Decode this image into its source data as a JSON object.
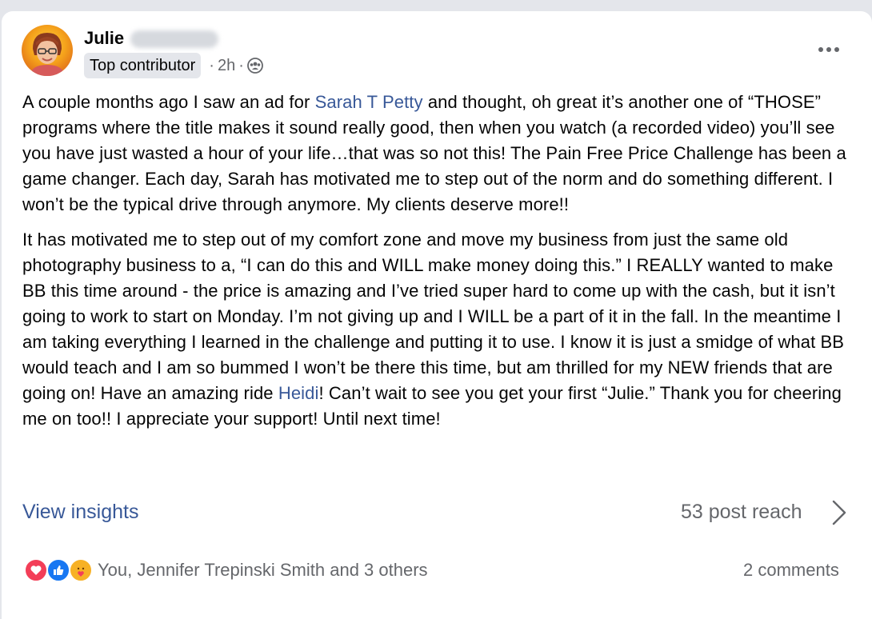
{
  "post": {
    "author_name": "Julie",
    "badge": "Top contributor",
    "time": "2h",
    "separator": "·",
    "paragraph1": {
      "before": "A couple months ago I saw an ad for ",
      "mention": "Sarah T Petty",
      "after": " and thought, oh great it’s another one of “THOSE” programs where the title makes it sound really good, then when you watch (a recorded video) you’ll see you have just wasted a hour of your life…that was so not this! The Pain Free Price Challenge has been a game changer. Each day, Sarah has motivated me to step out of the norm and do something different. I won’t be the typical drive through anymore. My clients deserve more!!"
    },
    "paragraph2": {
      "before": "It has motivated me to step out of my comfort zone and move my business from just the same old photography business to a, “I can do this and WILL make money doing this.” I REALLY wanted to make BB this time around - the price is amazing and I’ve tried super hard to come up with the cash, but it isn’t going to work to start on Monday. I’m not giving up and I WILL be a part of it in the fall. In the meantime I am taking everything I learned in the challenge and putting it to use. I know it is just a smidge of what BB would teach and I am so bummed I won’t be there this time, but am thrilled for my NEW friends that are going on! Have an amazing ride ",
      "mention": "Heidi",
      "after": "! Can’t wait to see you get your first “Julie.” Thank you for cheering me on too!! I appreciate your support! Until next time!"
    }
  },
  "footer": {
    "insights_label": "View insights",
    "reach_label": "53 post reach",
    "reactions_text": "You, Jennifer Trepinski Smith and 3 others",
    "comments_label": "2 comments"
  },
  "icons": {
    "more": "more-horizontal-icon",
    "audience": "group-audience-icon",
    "chevron": "chevron-right-icon",
    "reactions": [
      "love-reaction-icon",
      "like-reaction-icon",
      "care-reaction-icon"
    ]
  },
  "colors": {
    "link": "#385898",
    "secondary_text": "#65676b",
    "badge_bg": "#e4e6eb",
    "like_blue": "#1877f2",
    "love_red": "#f33e58",
    "care_yellow": "#f7b125"
  }
}
